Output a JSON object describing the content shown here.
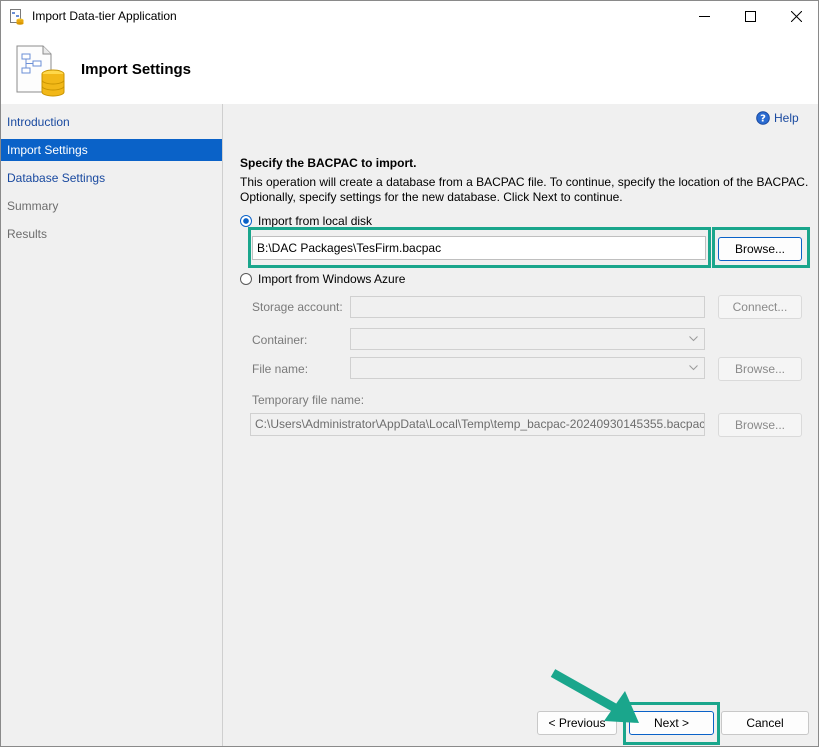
{
  "window": {
    "title": "Import Data-tier Application",
    "minimize_icon": "minimize-icon",
    "maximize_icon": "maximize-icon",
    "close_icon": "close-icon"
  },
  "header": {
    "title": "Import Settings",
    "icon": "database-wizard-icon"
  },
  "sidebar": {
    "items": [
      {
        "label": "Introduction",
        "state": "link"
      },
      {
        "label": "Import Settings",
        "state": "active"
      },
      {
        "label": "Database Settings",
        "state": "link"
      },
      {
        "label": "Summary",
        "state": "disabled"
      },
      {
        "label": "Results",
        "state": "disabled"
      }
    ]
  },
  "help": {
    "label": "Help",
    "icon": "help-icon"
  },
  "main": {
    "heading": "Specify the BACPAC to import.",
    "description": "This operation will create a database from a BACPAC file. To continue, specify the location of the BACPAC. Optionally, specify settings for the new database. Click Next to continue.",
    "local_disk": {
      "label": "Import from local disk",
      "selected": true,
      "path_value": "B:\\DAC Packages\\TesFirm.bacpac",
      "browse_label": "Browse..."
    },
    "azure": {
      "label": "Import from Windows Azure",
      "selected": false,
      "storage_account_label": "Storage account:",
      "storage_account_value": "",
      "connect_label": "Connect...",
      "container_label": "Container:",
      "container_value": "",
      "file_name_label": "File name:",
      "file_name_value": "",
      "browse_label": "Browse...",
      "temp_file_label": "Temporary file name:",
      "temp_file_value": "C:\\Users\\Administrator\\AppData\\Local\\Temp\\temp_bacpac-20240930145355.bacpac",
      "temp_browse_label": "Browse..."
    }
  },
  "footer": {
    "previous_label": "< Previous",
    "next_label": "Next >",
    "cancel_label": "Cancel"
  },
  "colors": {
    "accent": "#0a62c8",
    "highlight": "#1aa68c",
    "sidebar_bg": "#f0f0f0"
  }
}
